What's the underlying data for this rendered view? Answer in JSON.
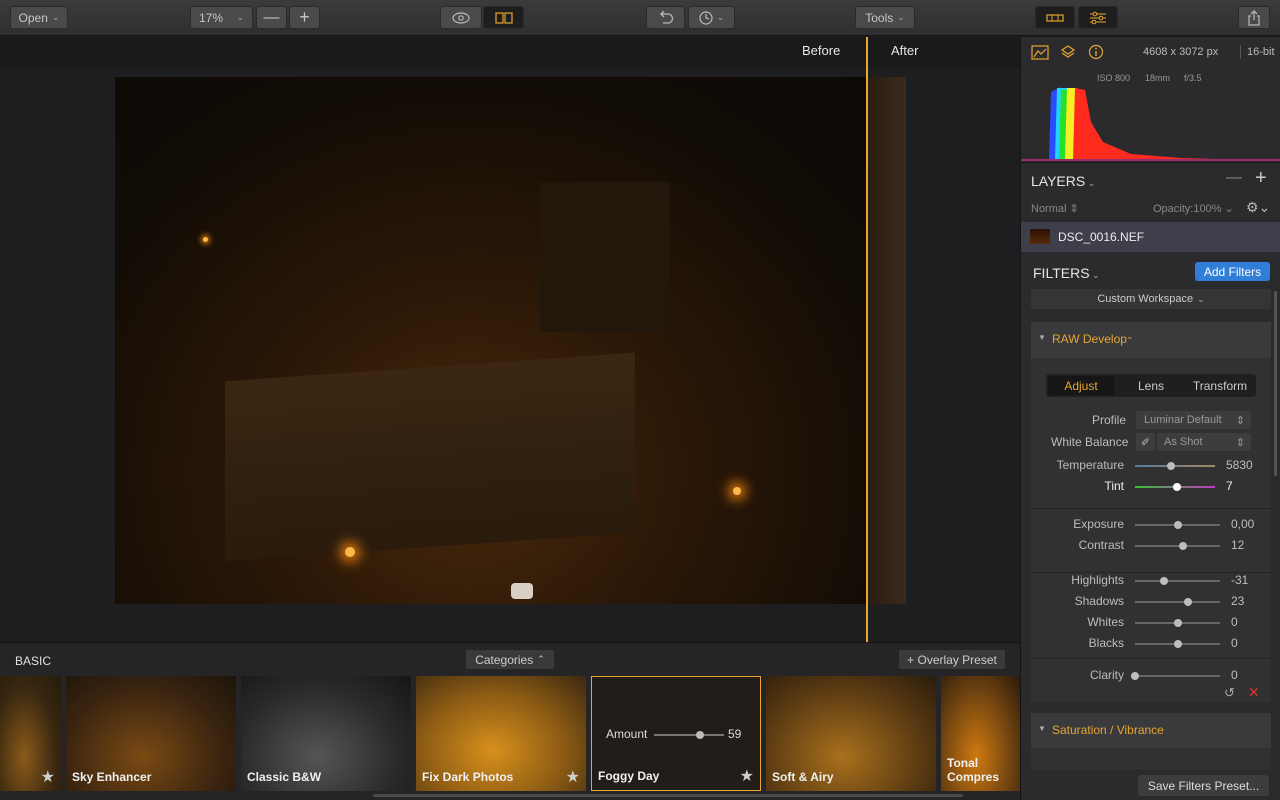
{
  "toolbar": {
    "open_label": "Open",
    "zoom_value": "17%",
    "tools_label": "Tools"
  },
  "compare": {
    "before_label": "Before",
    "after_label": "After"
  },
  "info": {
    "dimensions": "4608 x 3072 px",
    "bit_depth": "16-bit",
    "iso": "ISO 800",
    "focal": "18mm",
    "aperture": "f/3.5"
  },
  "layers": {
    "title": "LAYERS",
    "blend_mode": "Normal",
    "opacity_label": "Opacity:",
    "opacity_value": "100%",
    "layer_name": "DSC_0016.NEF"
  },
  "filters": {
    "title": "FILTERS",
    "add_button": "Add Filters",
    "workspace": "Custom Workspace",
    "raw_develop": "RAW Develop",
    "tabs": [
      "Adjust",
      "Lens",
      "Transform"
    ],
    "profile_label": "Profile",
    "profile_value": "Luminar Default",
    "wb_label": "White Balance",
    "wb_value": "As Shot",
    "sliders": [
      {
        "label": "Temperature",
        "value": "5830",
        "pos": 0.45
      },
      {
        "label": "Tint",
        "value": "7",
        "pos": 0.53
      },
      {
        "label": "Exposure",
        "value": "0,00",
        "pos": 0.5
      },
      {
        "label": "Contrast",
        "value": "12",
        "pos": 0.56
      },
      {
        "label": "Highlights",
        "value": "-31",
        "pos": 0.34
      },
      {
        "label": "Shadows",
        "value": "23",
        "pos": 0.62
      },
      {
        "label": "Whites",
        "value": "0",
        "pos": 0.5
      },
      {
        "label": "Blacks",
        "value": "0",
        "pos": 0.5
      },
      {
        "label": "Clarity",
        "value": "0",
        "pos": 0.0
      }
    ],
    "saturation": "Saturation / Vibrance",
    "save_preset": "Save Filters Preset..."
  },
  "presets": {
    "category": "BASIC",
    "categories_button": "Categories",
    "overlay_button": "+ Overlay Preset",
    "amount_label": "Amount",
    "amount_value": "59",
    "items": [
      "Sky Enhancer",
      "Classic B&W",
      "Fix Dark Photos",
      "Foggy Day",
      "Soft & Airy",
      "Tonal Compres"
    ]
  },
  "colors": {
    "accent": "#e8a530",
    "blue": "#2f7fd8"
  }
}
